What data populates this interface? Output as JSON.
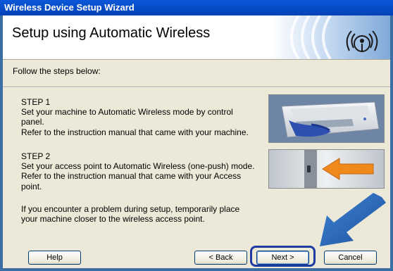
{
  "window": {
    "title": "Wireless Device Setup Wizard"
  },
  "header": {
    "title": "Setup using Automatic Wireless"
  },
  "intro": "Follow the steps below:",
  "steps": [
    {
      "heading": "STEP 1",
      "lines": [
        "Set your machine to Automatic Wireless mode by control",
        "panel.",
        "Refer to the instruction manual that came with your machine."
      ]
    },
    {
      "heading": "STEP 2",
      "lines": [
        "Set your access point to Automatic Wireless (one-push) mode.",
        "Refer to the instruction manual that came with your Access",
        "point."
      ]
    }
  ],
  "note": {
    "lines": [
      "If you encounter a problem during setup, temporarily place",
      "your machine closer to the wireless access point."
    ]
  },
  "buttons": {
    "help": "Help",
    "back": "< Back",
    "next": "Next >",
    "cancel": "Cancel"
  },
  "colors": {
    "title_bar": "#0a58d8",
    "dialog_bg": "#ece9d8",
    "highlight_arrow": "#2a6ab5"
  }
}
